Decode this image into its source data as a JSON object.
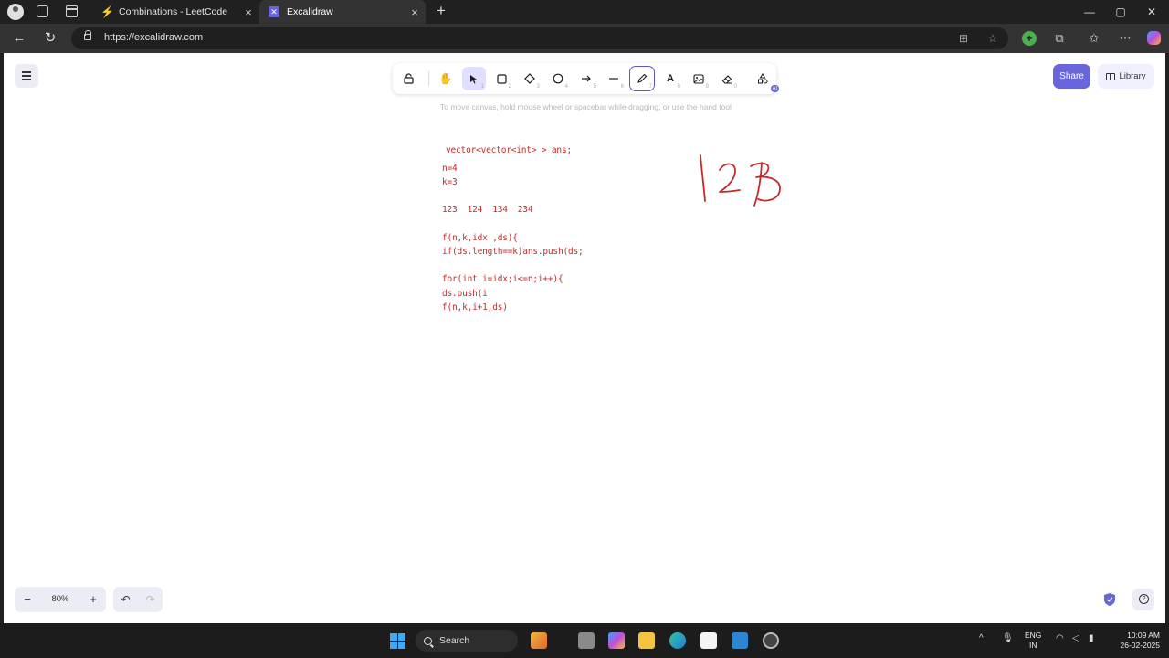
{
  "browser": {
    "tabs": [
      {
        "title": "Combinations - LeetCode",
        "favicon": "leetcode-icon",
        "active": false
      },
      {
        "title": "Excalidraw",
        "favicon": "excalidraw-icon",
        "active": true
      }
    ],
    "new_tab": "+",
    "url": "https://excalidraw.com",
    "window_controls": {
      "minimize": "—",
      "maximize": "▢",
      "close": "✕"
    }
  },
  "excalidraw": {
    "toolbar": [
      {
        "name": "lock",
        "icon": "lock-icon",
        "shortcut": ""
      },
      {
        "name": "hand",
        "icon": "hand-icon",
        "shortcut": ""
      },
      {
        "name": "selection",
        "icon": "pointer-icon",
        "shortcut": "1"
      },
      {
        "name": "rectangle",
        "icon": "rectangle-icon",
        "shortcut": "2"
      },
      {
        "name": "diamond",
        "icon": "diamond-icon",
        "shortcut": "3"
      },
      {
        "name": "ellipse",
        "icon": "ellipse-icon",
        "shortcut": "4"
      },
      {
        "name": "arrow",
        "icon": "arrow-icon",
        "shortcut": "5"
      },
      {
        "name": "line",
        "icon": "line-icon",
        "shortcut": "6"
      },
      {
        "name": "draw",
        "icon": "pencil-icon",
        "shortcut": "7"
      },
      {
        "name": "text",
        "icon": "text-icon",
        "shortcut": "8"
      },
      {
        "name": "image",
        "icon": "image-icon",
        "shortcut": "9"
      },
      {
        "name": "eraser",
        "icon": "eraser-icon",
        "shortcut": "0"
      },
      {
        "name": "more-tools",
        "icon": "shapes-icon",
        "shortcut": "",
        "badge": "AI"
      }
    ],
    "hint": "To move canvas, hold mouse wheel or spacebar while dragging, or use the hand tool",
    "share_label": "Share",
    "library_label": "Library",
    "zoom": "80%",
    "zoom_out": "−",
    "zoom_in": "+",
    "canvas_lines": [
      "vector<vector<int> > ans;",
      "n=4",
      "k=3",
      "123  124  134  234",
      "f(n,k,idx ,ds){",
      "if(ds.length==k)ans.push(ds;",
      "for(int i=idx;i<=n;i++){",
      "ds.push(i",
      "f(n,k,i+1,ds)"
    ],
    "sketch_text": "123",
    "ink_color": "#c42b2b"
  },
  "taskbar": {
    "search_label": "Search",
    "language": [
      "ENG",
      "IN"
    ],
    "time": "10:09 AM",
    "date": "26-02-2025"
  }
}
